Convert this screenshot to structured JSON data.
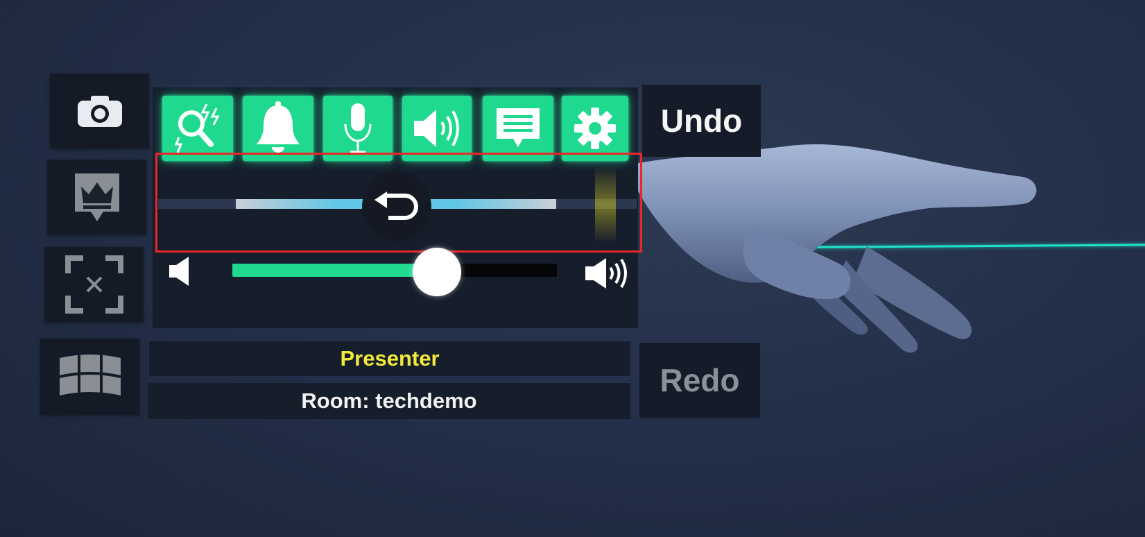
{
  "toolbar": {
    "undo_label": "Undo",
    "redo_label": "Redo"
  },
  "side_buttons": [
    {
      "icon": "camera-icon"
    },
    {
      "icon": "crown-icon"
    },
    {
      "icon": "exit-fullscreen-icon"
    },
    {
      "icon": "curved-grid-icon"
    }
  ],
  "top_icons": [
    {
      "icon": "search-lightning-icon"
    },
    {
      "icon": "bell-icon"
    },
    {
      "icon": "microphone-icon"
    },
    {
      "icon": "speaker-icon"
    },
    {
      "icon": "chat-icon"
    },
    {
      "icon": "gear-icon"
    }
  ],
  "timeline_slider": {
    "icon": "undo-arrow-icon"
  },
  "volume_slider": {
    "value_percent": 63
  },
  "status": {
    "role": "Presenter",
    "room": "Room: techdemo"
  },
  "colors": {
    "accent": "#1fd98f",
    "role": "#f2e93a",
    "highlight_box": "#e8272b",
    "laser": "#1fe3c8"
  }
}
